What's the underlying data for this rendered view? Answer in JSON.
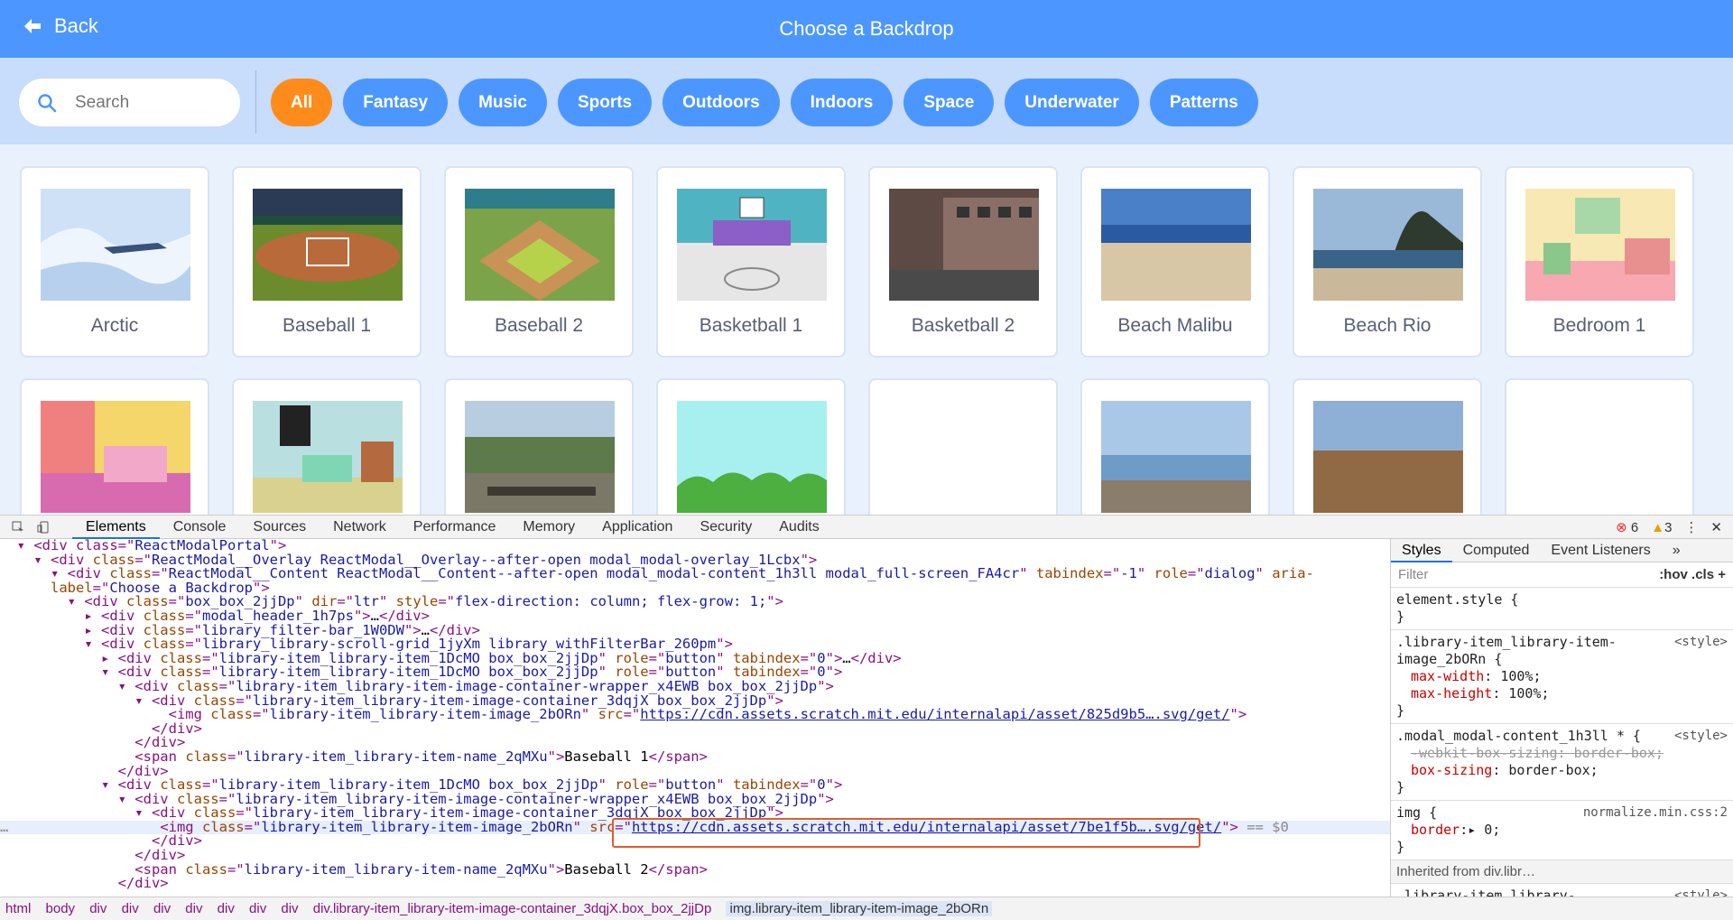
{
  "header": {
    "back_label": "Back",
    "title": "Choose a Backdrop"
  },
  "search": {
    "placeholder": "Search"
  },
  "tags": [
    "All",
    "Fantasy",
    "Music",
    "Sports",
    "Outdoors",
    "Indoors",
    "Space",
    "Underwater",
    "Patterns"
  ],
  "active_tag": "All",
  "colors": {
    "header": "#4c97ff",
    "filter_bar": "#c8dcfb",
    "active_tag": "#ff8c1a",
    "grid_bg": "#e9f1fc"
  },
  "backdrops_row1": [
    "Arctic",
    "Baseball 1",
    "Baseball 2",
    "Basketball 1",
    "Basketball 2",
    "Beach Malibu",
    "Beach Rio",
    "Bedroom 1"
  ],
  "devtools": {
    "tabs": [
      "Elements",
      "Console",
      "Sources",
      "Network",
      "Performance",
      "Memory",
      "Application",
      "Security",
      "Audits"
    ],
    "errors": "6",
    "warnings": "3",
    "styles_tabs": [
      "Styles",
      "Computed",
      "Event Listeners",
      "»"
    ],
    "filter_placeholder": "Filter",
    "filter_hov": ":hov",
    "filter_cls": ".cls",
    "inherited_from": "Inherited from div.libr…",
    "breadcrumb": [
      "html",
      "body",
      "div",
      "div",
      "div",
      "div",
      "div",
      "div",
      "div",
      "div.library-item_library-item-image-container_3dqjX.box_box_2jjDp",
      "img.library-item_library-item-image_2bORn"
    ]
  }
}
